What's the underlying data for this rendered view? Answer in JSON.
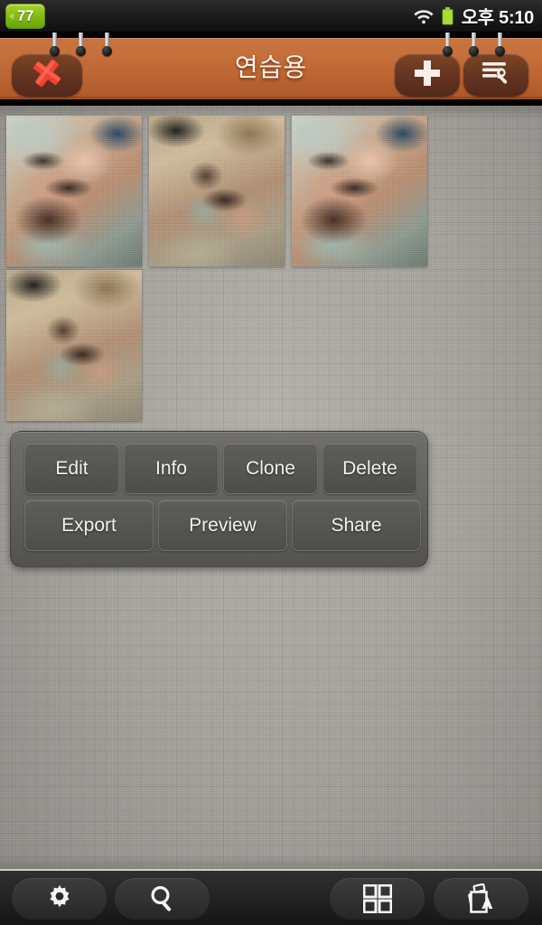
{
  "status_bar": {
    "battery_widget_percent": "77",
    "icons": [
      "wifi-icon",
      "battery-icon"
    ],
    "clock": "오후 5:10"
  },
  "titlebar": {
    "title": "연습용",
    "close_label": "close-icon",
    "add_label": "plus-icon",
    "tools_label": "settings-tools-icon",
    "accent_color": "#c4703e",
    "button_color": "#633320",
    "close_icon_color": "#ef3b2c"
  },
  "gallery": {
    "thumbnails": [
      {
        "name": "thumbnail-1",
        "art": "art-a"
      },
      {
        "name": "thumbnail-2",
        "art": "art-b"
      },
      {
        "name": "thumbnail-3",
        "art": "art-a"
      },
      {
        "name": "thumbnail-4",
        "art": "art-b"
      }
    ]
  },
  "action_panel": {
    "row1": [
      "Edit",
      "Info",
      "Clone",
      "Delete"
    ],
    "row2": [
      "Export",
      "Preview",
      "Share"
    ]
  },
  "bottom_toolbar": {
    "items": [
      {
        "name": "settings-button",
        "icon": "gear-icon"
      },
      {
        "name": "search-button",
        "icon": "search-icon"
      },
      {
        "name": "grid-view-button",
        "icon": "grid-icon"
      },
      {
        "name": "sort-button",
        "icon": "sort-alpha-icon"
      }
    ]
  },
  "colors": {
    "background": "#aba8a2",
    "titlebar": "#c4703e",
    "panel": "#5f5e59",
    "toolbar": "#242424",
    "battery_green": "#83bb14"
  }
}
